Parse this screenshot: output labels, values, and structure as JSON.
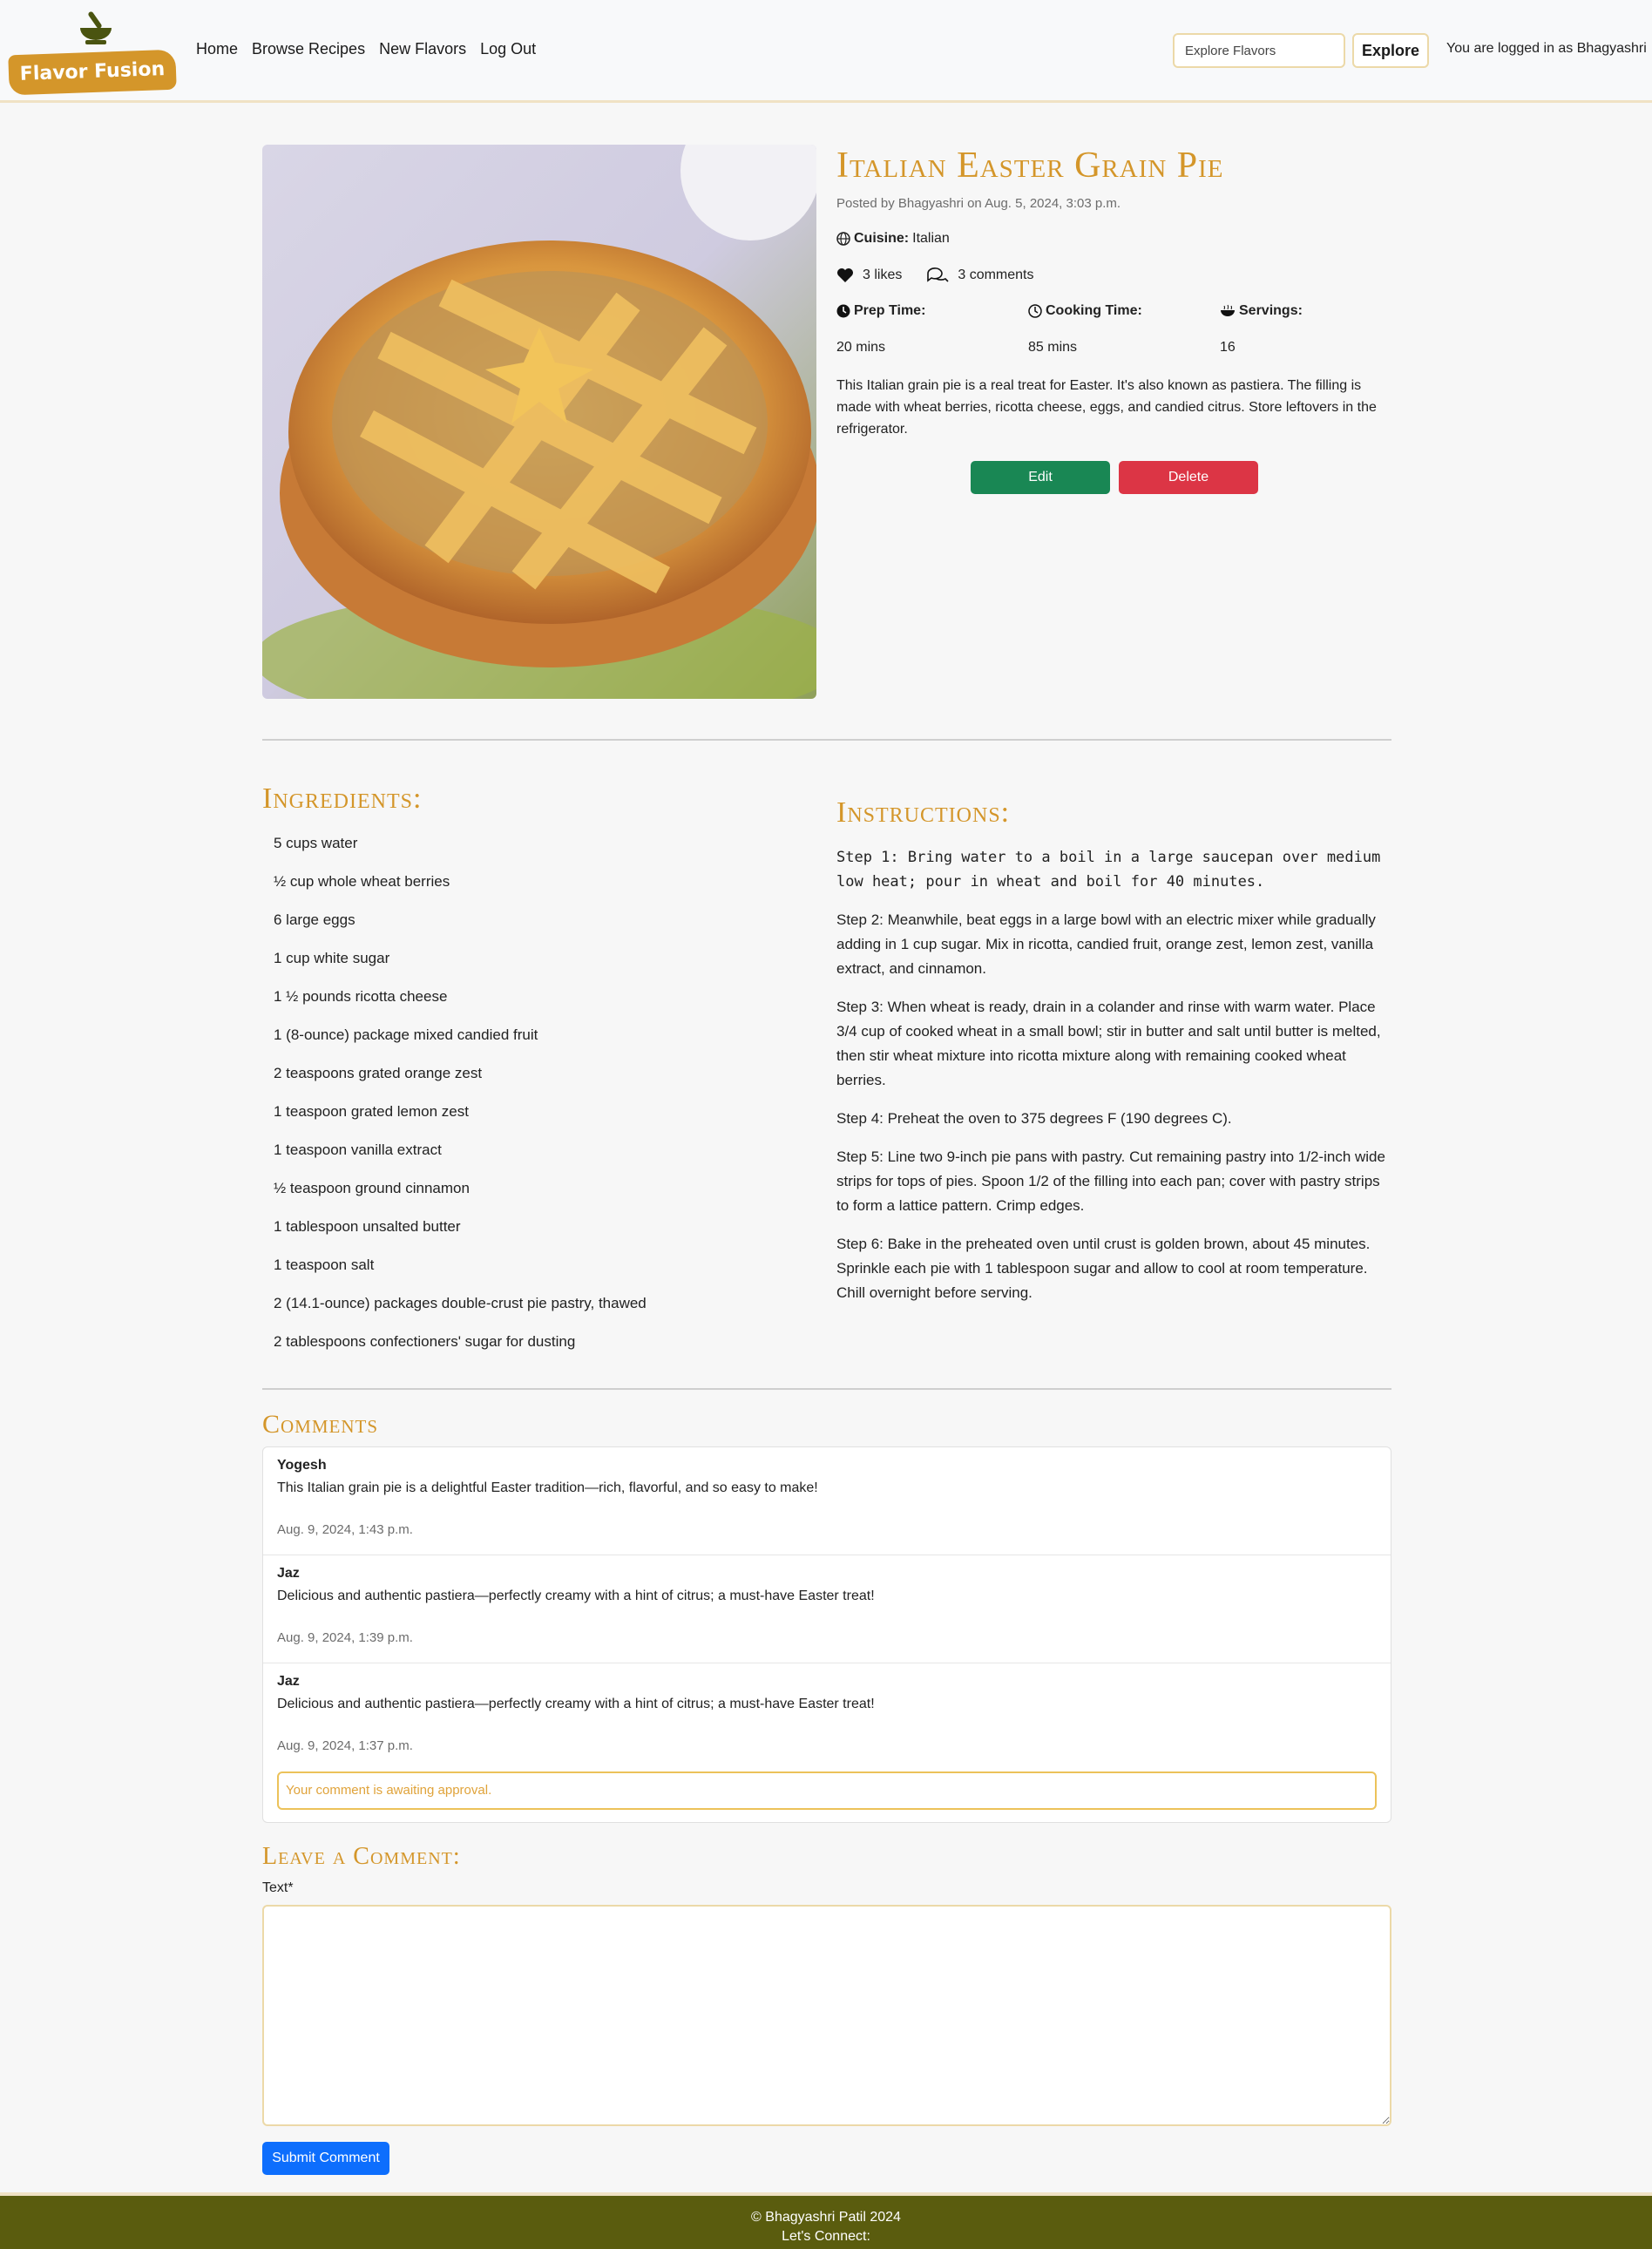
{
  "nav": {
    "logo_text": "Flavor Fusion",
    "links": [
      "Home",
      "Browse Recipes",
      "New Flavors",
      "Log Out"
    ],
    "search_placeholder": "Explore Flavors",
    "search_button": "Explore",
    "login_status": "You are logged in as Bhagyashri"
  },
  "recipe": {
    "title": "Italian Easter Grain Pie",
    "posted": "Posted by Bhagyashri on Aug. 5, 2024, 3:03 p.m.",
    "cuisine_label": "Cuisine:",
    "cuisine_value": "Italian",
    "likes": "3 likes",
    "comments_count": "3 comments",
    "prep_label": "Prep Time:",
    "prep_value": "20 mins",
    "cook_label": "Cooking Time:",
    "cook_value": "85 mins",
    "servings_label": "Servings:",
    "servings_value": "16",
    "description": "This Italian grain pie is a real treat for Easter. It's also known as pastiera. The filling is made with wheat berries, ricotta cheese, eggs, and candied citrus. Store leftovers in the refrigerator.",
    "edit_label": "Edit",
    "delete_label": "Delete"
  },
  "ingredients_heading": "Ingredients:",
  "ingredients": [
    "5 cups water",
    "½ cup whole wheat berries",
    "6 large eggs",
    "1 cup white sugar",
    "1 ½ pounds ricotta cheese",
    "1 (8-ounce) package mixed candied fruit",
    "2 teaspoons grated orange zest",
    "1 teaspoon grated lemon zest",
    "1 teaspoon vanilla extract",
    "½ teaspoon ground cinnamon",
    "1 tablespoon unsalted butter",
    "1 teaspoon salt",
    "2 (14.1-ounce) packages double-crust pie pastry, thawed",
    "2 tablespoons confectioners' sugar for dusting"
  ],
  "instructions_heading": "Instructions:",
  "instructions": [
    "Step 1: Bring water to a boil in a large saucepan over medium low heat; pour in wheat and boil for 40 minutes.",
    "Step 2: Meanwhile, beat eggs in a large bowl with an electric mixer while gradually adding in 1 cup sugar. Mix in ricotta, candied fruit, orange zest, lemon zest, vanilla extract, and cinnamon.",
    "Step 3: When wheat is ready, drain in a colander and rinse with warm water. Place 3/4 cup of cooked wheat in a small bowl; stir in butter and salt until butter is melted, then stir wheat mixture into ricotta mixture along with remaining cooked wheat berries.",
    "Step 4: Preheat the oven to 375 degrees F (190 degrees C).",
    "Step 5: Line two 9-inch pie pans with pastry. Cut remaining pastry into 1/2-inch wide strips for tops of pies. Spoon 1/2 of the filling into each pan; cover with pastry strips to form a lattice pattern. Crimp edges.",
    "Step 6: Bake in the preheated oven until crust is golden brown, about 45 minutes. Sprinkle each pie with 1 tablespoon sugar and allow to cool at room temperature. Chill overnight before serving."
  ],
  "comments_heading": "Comments",
  "comments": [
    {
      "author": "Yogesh",
      "text": "This Italian grain pie is a delightful Easter tradition—rich, flavorful, and so easy to make!",
      "date": "Aug. 9, 2024, 1:43 p.m."
    },
    {
      "author": "Jaz",
      "text": "Delicious and authentic pastiera—perfectly creamy with a hint of citrus; a must-have Easter treat!",
      "date": "Aug. 9, 2024, 1:39 p.m."
    },
    {
      "author": "Jaz",
      "text": "Delicious and authentic pastiera—perfectly creamy with a hint of citrus; a must-have Easter treat!",
      "date": "Aug. 9, 2024, 1:37 p.m."
    }
  ],
  "awaiting_approval": "Your comment is awaiting approval.",
  "leave_comment_heading": "Leave a Comment:",
  "text_label": "Text*",
  "submit_label": "Submit Comment",
  "footer": {
    "copyright": "© Bhagyashri Patil 2024",
    "connect": "Let's Connect:"
  },
  "colors": {
    "accent": "#d4962a",
    "edit": "#198754",
    "delete": "#dc3545",
    "submit": "#0d6efd",
    "footer": "#5a5c0e"
  }
}
